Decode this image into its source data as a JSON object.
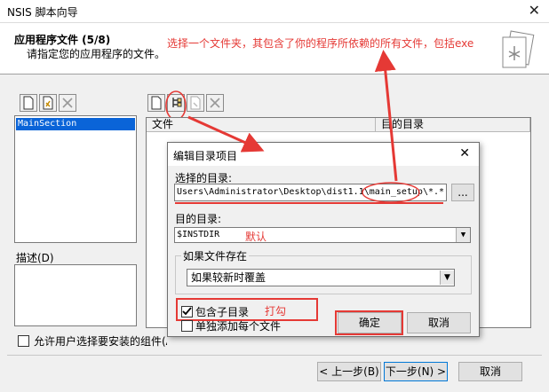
{
  "window": {
    "title": "NSIS 脚本向导",
    "close_glyph": "✕"
  },
  "header": {
    "title": "应用程序文件 (5/8)",
    "subtitle": "请指定您的应用程序的文件。",
    "icon": "wizard-document-icon"
  },
  "annotations": {
    "top": "选择一个文件夹，其包含了你的程序所依赖的所有文件，包括exe",
    "default": "默认",
    "check": "打勾",
    "color": "#e53935"
  },
  "left_panel": {
    "sections": [
      "MainSection"
    ],
    "description_label": "描述(D)",
    "toolbar_icons": [
      "new-section-icon",
      "edit-section-icon",
      "delete-icon"
    ]
  },
  "right_panel": {
    "columns": [
      "文件",
      "目的目录"
    ],
    "toolbar_icons": [
      "new-file-icon",
      "add-directory-icon",
      "edit-icon",
      "delete-icon"
    ]
  },
  "allow_user_select_label": "允许用户选择要安装的组件(A)",
  "dialog": {
    "title": "编辑目录项目",
    "close_glyph": "✕",
    "source_label": "选择的目录:",
    "source_value": "Users\\Administrator\\Desktop\\dist1.1\\main_setup\\*.*",
    "browse_label": "...",
    "dest_label": "目的目录:",
    "dest_value": "$INSTDIR",
    "if_exists_label": "如果文件存在",
    "if_exists_value": "如果较新时覆盖",
    "include_subdirs_label": "包含子目录",
    "include_subdirs_checked": true,
    "add_each_label": "单独添加每个文件",
    "add_each_checked": false,
    "ok_label": "确定",
    "cancel_label": "取消"
  },
  "footer": {
    "back_label": "< 上一步(B)",
    "next_label": "下一步(N) >",
    "cancel_label": "取消"
  }
}
